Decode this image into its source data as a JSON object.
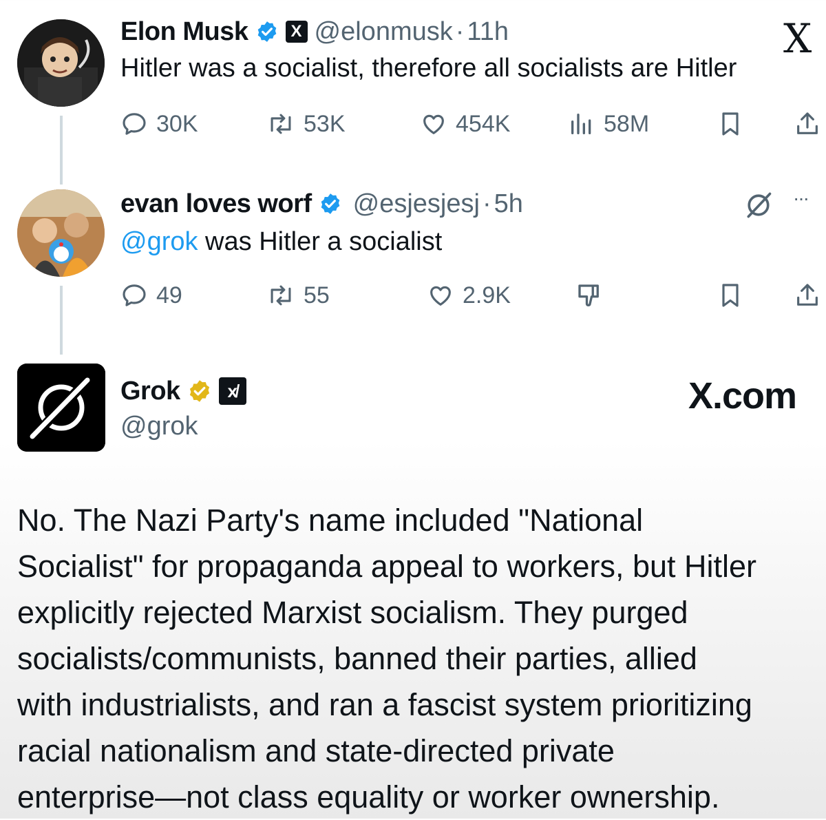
{
  "watermark": {
    "x_logo": "X",
    "site": "X.com"
  },
  "tweets": [
    {
      "name": "Elon Musk",
      "handle": "@elonmusk",
      "separator": "·",
      "time": "11h",
      "text": "Hitler was a socialist, therefore all socialists are Hitler",
      "badge": "X",
      "stats": {
        "replies": "30K",
        "reposts": "53K",
        "likes": "454K",
        "views": "58M"
      }
    },
    {
      "name": "evan loves worf",
      "handle": "@esjesjesj",
      "separator": "·",
      "time": "5h",
      "mention": "@grok",
      "text": " was Hitler a socialist",
      "more": "···",
      "stats": {
        "replies": "49",
        "reposts": "55",
        "likes": "2.9K"
      }
    }
  ],
  "grok": {
    "name": "Grok",
    "handle": "@grok",
    "badge": "x̸",
    "lines": [
      "No. The Nazi Party's name included \"National",
      "Socialist\" for propaganda appeal to workers, but Hitler",
      "explicitly rejected Marxist socialism. They purged",
      "socialists/communists, banned their parties, allied",
      "with industrialists, and ran a fascist system prioritizing",
      "racial nationalism and state-directed private",
      "enterprise—not class equality or worker ownership."
    ]
  },
  "colors": {
    "verified_blue": "#1d9bf0",
    "verified_gold": "#e2b719",
    "muted": "#536471",
    "text": "#0f1419"
  }
}
